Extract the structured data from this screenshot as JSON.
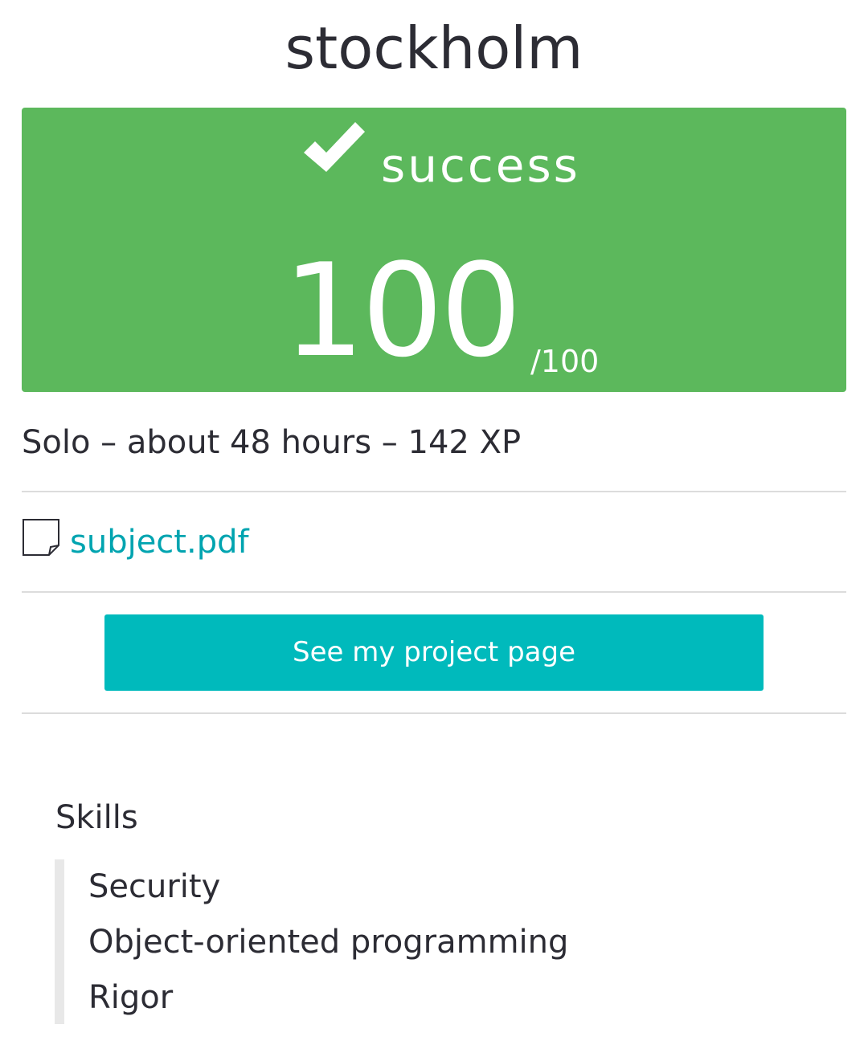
{
  "header": {
    "title": "stockholm"
  },
  "result": {
    "status": "success",
    "score": "100",
    "max_score": "/100",
    "status_icon": "check-icon",
    "color": "#5cb85c"
  },
  "meta": {
    "text": "Solo – about 48 hours – 142 XP"
  },
  "attachment": {
    "icon": "file-icon",
    "label": "subject.pdf",
    "link_color": "#00a4b0"
  },
  "actions": {
    "project_page_label": "See my project page",
    "button_color": "#00babc"
  },
  "skills": {
    "heading": "Skills",
    "items": [
      {
        "label": "Security"
      },
      {
        "label": "Object-oriented programming"
      },
      {
        "label": "Rigor"
      }
    ]
  }
}
